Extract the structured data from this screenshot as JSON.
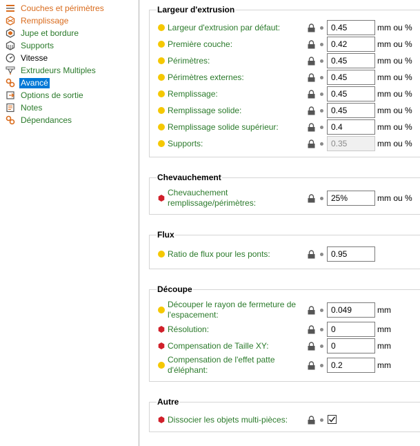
{
  "sidebar": {
    "items": [
      {
        "label": "Couches et périmètres",
        "icon": "layers-icon",
        "color": "#d96b1c"
      },
      {
        "label": "Remplissage",
        "icon": "infill-icon",
        "color": "#d96b1c"
      },
      {
        "label": "Jupe et bordure",
        "icon": "skirt-icon",
        "color": "#2b7a2b"
      },
      {
        "label": "Supports",
        "icon": "supports-icon",
        "color": "#2b7a2b"
      },
      {
        "label": "Vitesse",
        "icon": "speed-icon",
        "color": "#000000"
      },
      {
        "label": "Extrudeurs Multiples",
        "icon": "extruders-icon",
        "color": "#2b7a2b"
      },
      {
        "label": "Avancé",
        "icon": "advanced-icon",
        "color": "#ffffff",
        "selected": true
      },
      {
        "label": "Options de sortie",
        "icon": "output-icon",
        "color": "#2b7a2b"
      },
      {
        "label": "Notes",
        "icon": "notes-icon",
        "color": "#2b7a2b"
      },
      {
        "label": "Dépendances",
        "icon": "dependencies-icon",
        "color": "#2b7a2b"
      }
    ]
  },
  "sections": {
    "extrusion": {
      "title": "Largeur d'extrusion",
      "rows": [
        {
          "label": "Largeur d'extrusion par défaut:",
          "value": "0.45",
          "unit": "mm ou %"
        },
        {
          "label": "Première couche:",
          "value": "0.42",
          "unit": "mm ou %"
        },
        {
          "label": "Périmètres:",
          "value": "0.45",
          "unit": "mm ou %"
        },
        {
          "label": "Périmètres externes:",
          "value": "0.45",
          "unit": "mm ou %"
        },
        {
          "label": "Remplissage:",
          "value": "0.45",
          "unit": "mm ou %"
        },
        {
          "label": "Remplissage solide:",
          "value": "0.45",
          "unit": "mm ou %"
        },
        {
          "label": "Remplissage solide supérieur:",
          "value": "0.4",
          "unit": "mm ou %"
        },
        {
          "label": "Supports:",
          "value": "0.35",
          "unit": "mm ou %"
        }
      ]
    },
    "overlap": {
      "title": "Chevauchement",
      "rows": [
        {
          "label_line1": "Chevauchement",
          "label_line2": "remplissage/périmètres:",
          "value": "25%",
          "unit": "mm ou %"
        }
      ]
    },
    "flow": {
      "title": "Flux",
      "rows": [
        {
          "label": "Ratio de flux pour les ponts:",
          "value": "0.95"
        }
      ]
    },
    "slicing": {
      "title": "Découpe",
      "rows": [
        {
          "label_line1": "Découper le rayon de fermeture de",
          "label_line2": "l'espacement:",
          "value": "0.049",
          "unit": "mm"
        },
        {
          "label": "Résolution:",
          "value": "0",
          "unit": "mm"
        },
        {
          "label": "Compensation de Taille XY:",
          "value": "0",
          "unit": "mm"
        },
        {
          "label_line1": "Compensation de l'effet patte",
          "label_line2": "d'éléphant:",
          "value": "0.2",
          "unit": "mm"
        }
      ]
    },
    "other": {
      "title": "Autre",
      "rows": [
        {
          "label": "Dissocier les objets multi-pièces:",
          "checked": true
        }
      ]
    }
  },
  "colors": {
    "label_green": "#2b7a2b",
    "label_orange": "#d96b1c",
    "dot_yellow": "#f5c800",
    "dot_red": "#d0202a",
    "selection": "#0078d7"
  }
}
